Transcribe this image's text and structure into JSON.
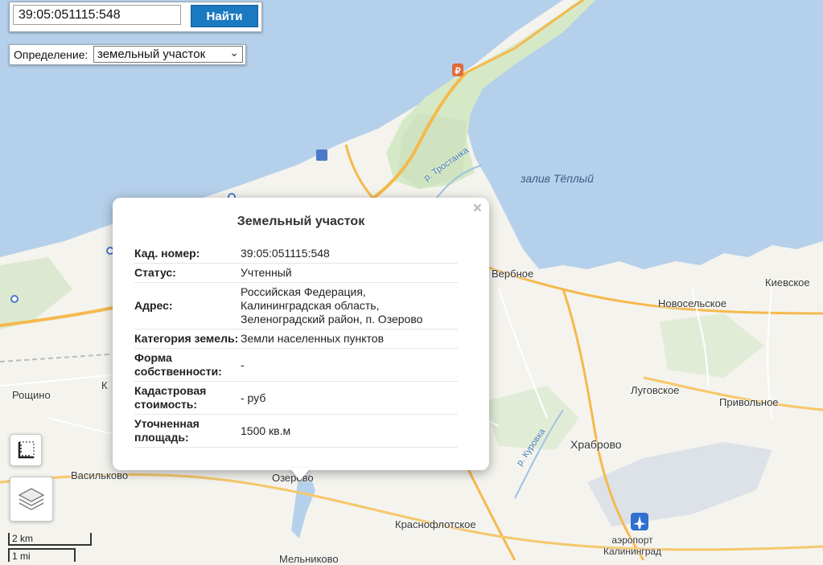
{
  "search": {
    "value": "39:05:051115:548",
    "button_label": "Найти"
  },
  "definition": {
    "label": "Определение:",
    "selected": "земельный участок"
  },
  "popup": {
    "title": "Земельный участок",
    "close_glyph": "×",
    "rows": [
      {
        "key": "Кад. номер:",
        "value": "39:05:051115:548"
      },
      {
        "key": "Статус:",
        "value": "Учтенный"
      },
      {
        "key": "Адрес:",
        "value": "Российская Федерация, Калининградская область, Зеленоградский район, п. Озерово"
      },
      {
        "key": "Категория земель:",
        "value": "Земли населенных пунктов"
      },
      {
        "key": "Форма собственности:",
        "value": "-"
      },
      {
        "key": "Кадастровая стоимость:",
        "value": "- руб"
      },
      {
        "key": "Уточненная площадь:",
        "value": "1500 кв.м"
      }
    ]
  },
  "map": {
    "labels": {
      "zaliv": "залив Тёплый",
      "trostanka": "р. Тростанка",
      "kurovka": "р. Куровка",
      "verbnoe": "Вербное",
      "kievskoe": "Киевское",
      "novoselskoe": "Новосельское",
      "roshchino": "Рощино",
      "lugovskoe": "Луговское",
      "privolnoe": "Привольное",
      "khrabrovo": "Храброво",
      "vasilkovo": "Васильково",
      "ozerovo": "Озерово",
      "krasnoflotskoe": "Краснофлотское",
      "airport_line1": "аэропорт",
      "airport_line2": "Калининград",
      "partial_k": "К",
      "partial_m": "Мельниково"
    },
    "colors": {
      "water": "#b5d0ea",
      "land": "#f4f3ee",
      "road_major": "#f5b94d",
      "road_minor": "#ffffff",
      "park": "#d6e9c6"
    }
  },
  "controls": {
    "ruler_icon": "ruler-icon",
    "layers_icon": "layers-icon"
  },
  "scale": {
    "km": "2 km",
    "mi": "1 mi"
  }
}
